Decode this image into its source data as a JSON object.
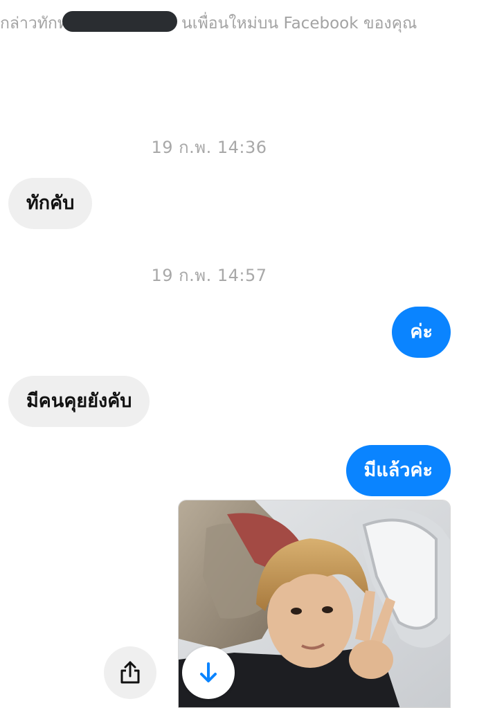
{
  "intro": {
    "prefix": "กล่าวทักท",
    "suffix": "นเพื่อนใหม่บน Facebook ของคุณ"
  },
  "conversation": {
    "timestamp_1": "19 ก.พ. 14:36",
    "timestamp_2": "19 ก.พ. 14:57",
    "messages": [
      {
        "side": "incoming",
        "text": "ทักคับ"
      },
      {
        "side": "outgoing",
        "text": "ค่ะ"
      },
      {
        "side": "incoming",
        "text": "มีคนคุยยังคับ"
      },
      {
        "side": "outgoing",
        "text": "มีแล้วค่ะ"
      }
    ],
    "attachment": {
      "kind": "photo"
    }
  },
  "actions": {
    "share_icon": "share-icon",
    "download_icon": "download-arrow-icon"
  },
  "colors": {
    "outgoing_bubble": "#0a84ff",
    "incoming_bubble": "#efefef",
    "timestamp_text": "#a8a8a8",
    "redaction": "#2a2d31"
  }
}
